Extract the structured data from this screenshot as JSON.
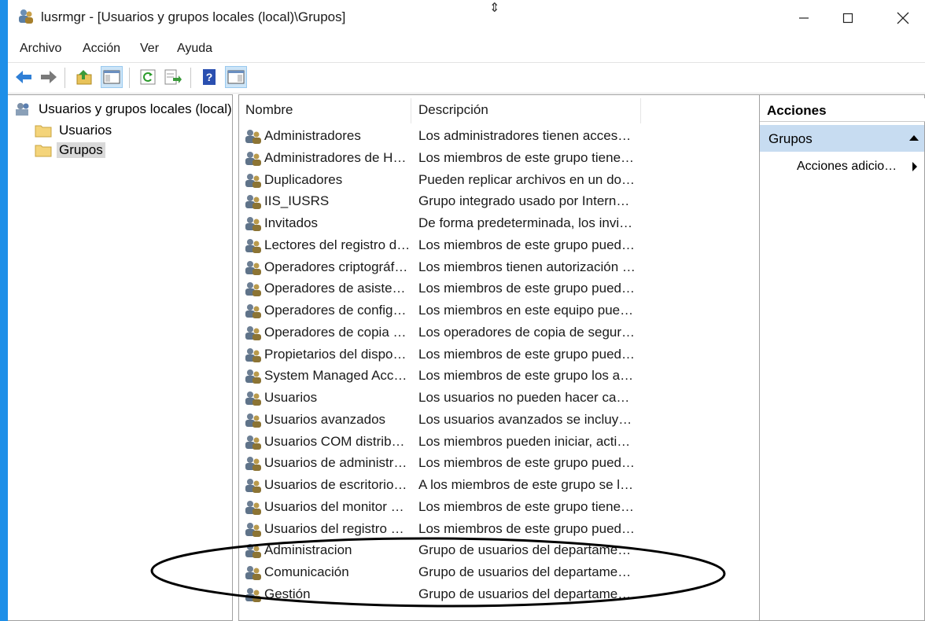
{
  "window": {
    "title": "lusrmgr - [Usuarios y grupos locales (local)\\Grupos]"
  },
  "menu": [
    "Archivo",
    "Acción",
    "Ver",
    "Ayuda"
  ],
  "toolbar_icons": [
    "back-arrow-icon",
    "forward-arrow-icon",
    "folder-up-icon",
    "show-hide-tree-icon",
    "refresh-icon",
    "export-list-icon",
    "help-icon",
    "show-hide-action-pane-icon"
  ],
  "tree": {
    "root": "Usuarios y grupos locales (local)",
    "children": [
      "Usuarios",
      "Grupos"
    ],
    "selected": "Grupos"
  },
  "list": {
    "columns": [
      "Nombre",
      "Descripción"
    ],
    "rows": [
      {
        "name": "Administradores",
        "desc": "Los administradores tienen acceso …"
      },
      {
        "name": "Administradores de Hy…",
        "desc": "Los miembros de este grupo tiene…"
      },
      {
        "name": "Duplicadores",
        "desc": "Pueden replicar archivos en un do…"
      },
      {
        "name": "IIS_IUSRS",
        "desc": "Grupo integrado usado por Intern…"
      },
      {
        "name": "Invitados",
        "desc": "De forma predeterminada, los invit…"
      },
      {
        "name": "Lectores del registro d…",
        "desc": "Los miembros de este grupo pued…"
      },
      {
        "name": "Operadores criptográfi…",
        "desc": "Los miembros tienen autorización …"
      },
      {
        "name": "Operadores de asisten…",
        "desc": "Los miembros de este grupo pued…"
      },
      {
        "name": "Operadores de config…",
        "desc": "Los miembros en este equipo pue…"
      },
      {
        "name": "Operadores de copia d…",
        "desc": "Los operadores de copia de seguri…"
      },
      {
        "name": "Propietarios del dispos…",
        "desc": "Los miembros de este grupo pued…"
      },
      {
        "name": "System Managed Acco…",
        "desc": "Los miembros de este grupo los a…"
      },
      {
        "name": "Usuarios",
        "desc": "Los usuarios no pueden hacer cam…"
      },
      {
        "name": "Usuarios avanzados",
        "desc": "Los usuarios avanzados se incluye…"
      },
      {
        "name": "Usuarios COM distribu…",
        "desc": "Los miembros pueden iniciar, activ…"
      },
      {
        "name": "Usuarios de administr…",
        "desc": "Los miembros de este grupo pued…"
      },
      {
        "name": "Usuarios de escritorio …",
        "desc": "A los miembros de este grupo se l…"
      },
      {
        "name": "Usuarios del monitor …",
        "desc": "Los miembros de este grupo tiene…"
      },
      {
        "name": "Usuarios del registro d…",
        "desc": "Los miembros de este grupo pued…"
      },
      {
        "name": "Administracion",
        "desc": "Grupo de usuarios del departame…"
      },
      {
        "name": "Comunicación",
        "desc": "Grupo de usuarios del departame…"
      },
      {
        "name": "Gestión",
        "desc": "Grupo de usuarios del departame…"
      }
    ]
  },
  "actions": {
    "title": "Acciones",
    "section": "Grupos",
    "item": "Acciones adicio…"
  },
  "colors": {
    "accent_edge": "#1e8fe8",
    "section_highlight": "#c7dcf1",
    "annotation": "#000000"
  }
}
